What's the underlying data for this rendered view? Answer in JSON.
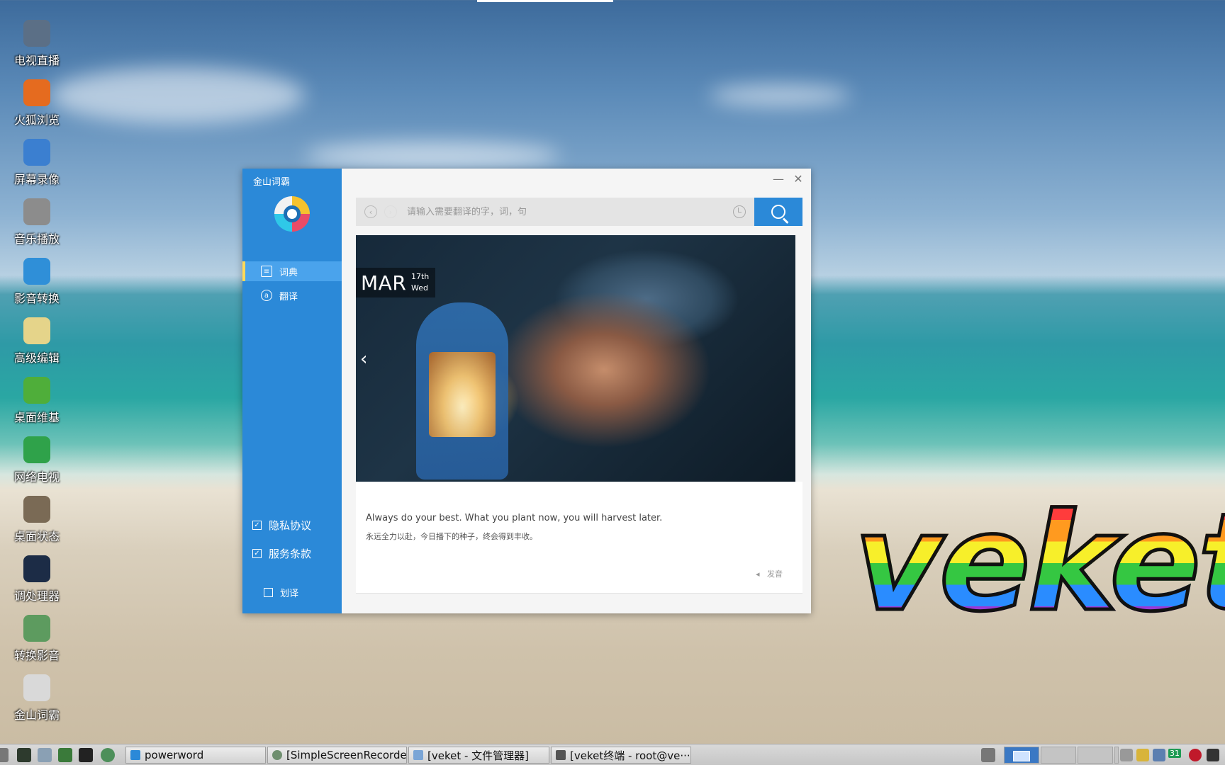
{
  "desktop": {
    "icons": [
      {
        "label": "电视直播",
        "icon": "tv-icon",
        "color": "#5b6f86"
      },
      {
        "label": "火狐浏览",
        "icon": "firefox-icon",
        "color": "#e56b1f"
      },
      {
        "label": "屏幕录像",
        "icon": "screen-record-icon",
        "color": "#3b7fd0"
      },
      {
        "label": "音乐播放",
        "icon": "speaker-icon",
        "color": "#8c8c8c"
      },
      {
        "label": "影音转换",
        "icon": "media-convert-icon",
        "color": "#2f8fd8"
      },
      {
        "label": "高级编辑",
        "icon": "notepad-icon",
        "color": "#e5d48a"
      },
      {
        "label": "桌面维基",
        "icon": "wiki-icon",
        "color": "#4fae3a"
      },
      {
        "label": "网络电视",
        "icon": "play-icon",
        "color": "#2fa24a"
      },
      {
        "label": "桌面状态",
        "icon": "gauge-icon",
        "color": "#7a6a55"
      },
      {
        "label": "调处理器",
        "icon": "cpu-icon",
        "color": "#1c2c46"
      },
      {
        "label": "转换影音",
        "icon": "convert-icon",
        "color": "#5d9b5f"
      },
      {
        "label": "金山词霸",
        "icon": "dictionary-icon",
        "color": "#d9d9d9"
      }
    ],
    "wallpaper_logo": "veket"
  },
  "app": {
    "title": "金山词霸",
    "nav": [
      {
        "label": "词典",
        "icon": "dictionary-nav-icon",
        "active": true
      },
      {
        "label": "翻译",
        "icon": "translate-nav-icon",
        "active": false
      }
    ],
    "privacy_label": "隐私协议",
    "terms_label": "服务条款",
    "scan_translate_label": "划译",
    "search": {
      "placeholder": "请输入需要翻译的字，词，句",
      "value": ""
    },
    "daily": {
      "month": "MAR",
      "day": "17th",
      "weekday": "Wed",
      "quote_en": "Always do your best. What you plant now, you will harvest later.",
      "quote_zh": "永远全力以赴，今日播下的种子，终会得到丰收。",
      "speak_label": "发音"
    },
    "colors": {
      "sidebar": "#2b89d8",
      "active_item": "#4aa3ec",
      "accent": "#ffd95a"
    }
  },
  "taskbar": {
    "tasks": [
      {
        "label": "powerword",
        "icon": "powerword-task-icon",
        "color": "#2b89d8"
      },
      {
        "label": "[SimpleScreenRecorder]",
        "icon": "recorder-task-icon",
        "color": "#6f8f6f"
      },
      {
        "label": "[veket - 文件管理器]",
        "icon": "folder-task-icon",
        "color": "#7aa5d6"
      },
      {
        "label": "[veket终端 - root@ve···",
        "icon": "terminal-task-icon",
        "color": "#555555"
      }
    ],
    "tray_number": "31"
  }
}
